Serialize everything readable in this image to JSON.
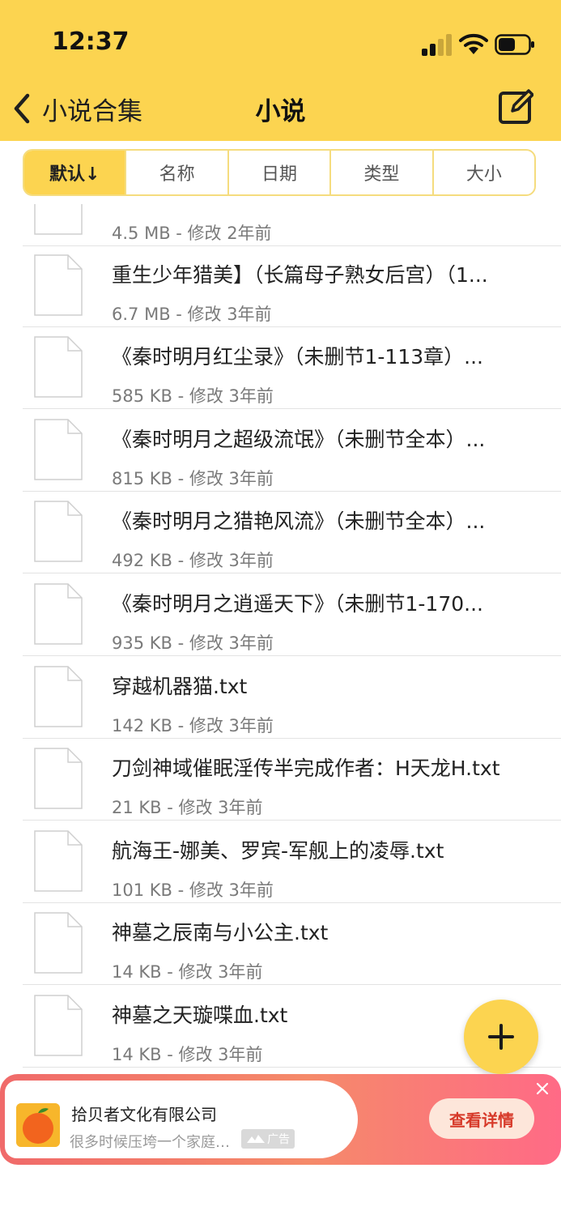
{
  "status_bar": {
    "time": "12:37"
  },
  "nav": {
    "back_label": "小说合集",
    "title": "小说"
  },
  "sort_tabs": [
    {
      "label": "默认↓",
      "active": true
    },
    {
      "label": "名称",
      "active": false
    },
    {
      "label": "日期",
      "active": false
    },
    {
      "label": "类型",
      "active": false
    },
    {
      "label": "大小",
      "active": false
    }
  ],
  "files": [
    {
      "name": "",
      "meta": "4.5 MB - 修改 2年前"
    },
    {
      "name": "重生少年猎美】（长篇母子熟女后宫）（1...",
      "meta": "6.7 MB - 修改 3年前"
    },
    {
      "name": "《秦时明月红尘录》（未删节1-113章）...",
      "meta": "585 KB - 修改 3年前"
    },
    {
      "name": "《秦时明月之超级流氓》（未删节全本）...",
      "meta": "815 KB - 修改 3年前"
    },
    {
      "name": "《秦时明月之猎艳风流》（未删节全本）...",
      "meta": "492 KB - 修改 3年前"
    },
    {
      "name": "《秦时明月之逍遥天下》（未删节1-170...",
      "meta": "935 KB - 修改 3年前"
    },
    {
      "name": "穿越机器猫.txt",
      "meta": "142 KB - 修改 3年前"
    },
    {
      "name": "刀剑神域催眠淫传半完成作者：H天龙H.txt",
      "meta": "21 KB - 修改 3年前"
    },
    {
      "name": "航海王-娜美、罗宾-军舰上的凌辱.txt",
      "meta": "101 KB - 修改 3年前"
    },
    {
      "name": "神墓之辰南与小公主.txt",
      "meta": "14 KB - 修改 3年前"
    },
    {
      "name": "神墓之天璇喋血.txt",
      "meta": "14 KB - 修改 3年前"
    }
  ],
  "ad": {
    "title": "拾贝者文化有限公司",
    "description": "很多时候压垮一个家庭…",
    "tag": "广告",
    "button": "查看详情"
  },
  "colors": {
    "header": "#fcd450",
    "divider": "#e3e3e3",
    "ad_button_text": "#d73a2a"
  }
}
